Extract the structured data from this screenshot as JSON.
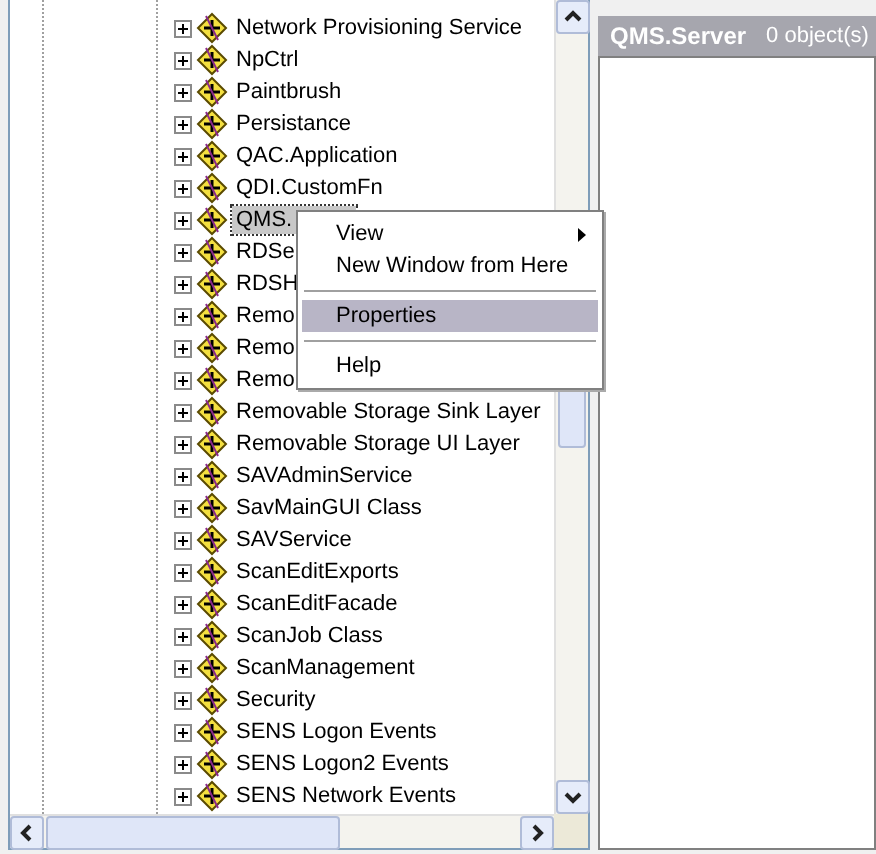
{
  "tree": {
    "items": [
      {
        "label": "Network Provisioning Service",
        "selected": false
      },
      {
        "label": "NpCtrl",
        "selected": false
      },
      {
        "label": "Paintbrush",
        "selected": false
      },
      {
        "label": "Persistance",
        "selected": false
      },
      {
        "label": "QAC.Application",
        "selected": false
      },
      {
        "label": "QDI.CustomFn",
        "selected": false
      },
      {
        "label": "QMS.",
        "selected": true
      },
      {
        "label": "RDSe",
        "selected": false
      },
      {
        "label": "RDSH",
        "selected": false
      },
      {
        "label": "Remo",
        "selected": false
      },
      {
        "label": "Remo",
        "selected": false
      },
      {
        "label": "Remo",
        "selected": false
      },
      {
        "label": "Removable Storage Sink Layer",
        "selected": false
      },
      {
        "label": "Removable Storage UI Layer",
        "selected": false
      },
      {
        "label": "SAVAdminService",
        "selected": false
      },
      {
        "label": "SavMainGUI Class",
        "selected": false
      },
      {
        "label": "SAVService",
        "selected": false
      },
      {
        "label": "ScanEditExports",
        "selected": false
      },
      {
        "label": "ScanEditFacade",
        "selected": false
      },
      {
        "label": "ScanJob Class",
        "selected": false
      },
      {
        "label": "ScanManagement",
        "selected": false
      },
      {
        "label": "Security",
        "selected": false
      },
      {
        "label": "SENS Logon Events",
        "selected": false
      },
      {
        "label": "SENS Logon2 Events",
        "selected": false
      },
      {
        "label": "SENS Network Events",
        "selected": false
      }
    ]
  },
  "context_menu": {
    "items": [
      {
        "kind": "item",
        "label": "View",
        "submenu": true,
        "selected": false
      },
      {
        "kind": "item",
        "label": "New Window from Here",
        "submenu": false,
        "selected": false
      },
      {
        "kind": "separator"
      },
      {
        "kind": "item",
        "label": "Properties",
        "submenu": false,
        "selected": true
      },
      {
        "kind": "separator"
      },
      {
        "kind": "item",
        "label": "Help",
        "submenu": false,
        "selected": false
      }
    ]
  },
  "detail_pane": {
    "title": "QMS.Server",
    "count": "0 object(s)"
  }
}
